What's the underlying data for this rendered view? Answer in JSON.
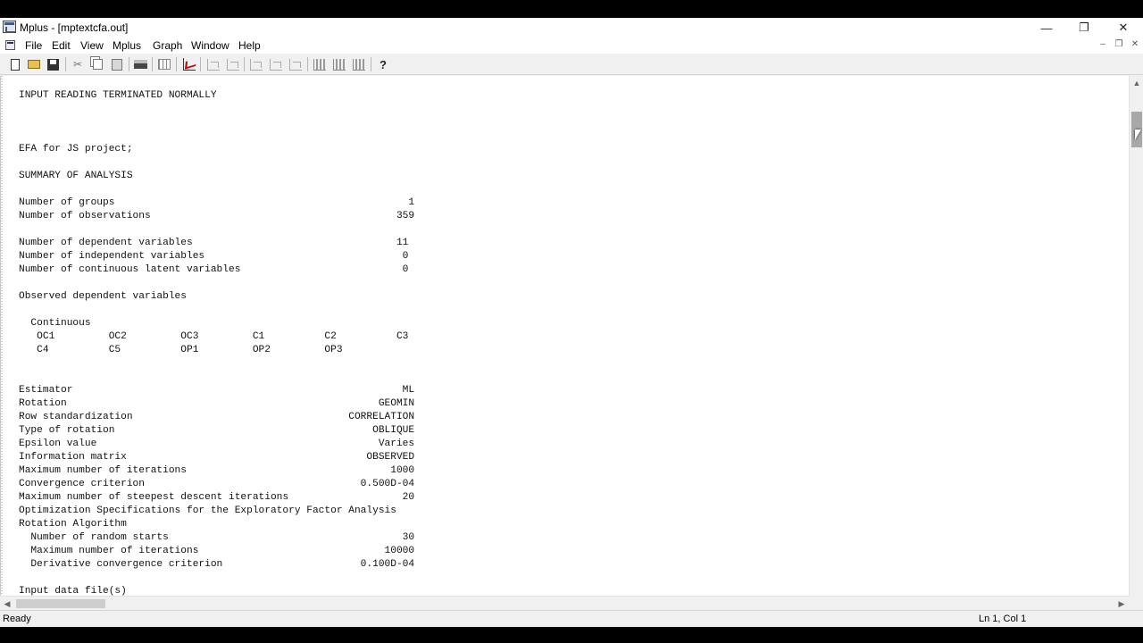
{
  "window": {
    "title": "Mplus - [mptextcfa.out]",
    "minimize_glyph": "—",
    "restore_glyph": "❐",
    "close_glyph": "✕"
  },
  "menu": {
    "items": [
      "File",
      "Edit",
      "View",
      "Mplus",
      "Graph",
      "Window",
      "Help"
    ],
    "mdi_minimize": "–",
    "mdi_restore": "❐",
    "mdi_close": "✕"
  },
  "toolbar": {
    "icons": [
      "new-file-icon",
      "open-folder-icon",
      "save-icon",
      "cut-icon",
      "copy-icon",
      "paste-icon",
      "print-icon",
      "data-grid-icon",
      "plot-icon",
      "line-plot-disabled-icon",
      "scatter-disabled-icon",
      "prev-disabled-icon",
      "next-disabled-icon",
      "zoom-disabled-icon",
      "histogram-icon",
      "bar-chart-icon",
      "column-chart-icon",
      "help-icon"
    ],
    "help_label": "?"
  },
  "document": {
    "lines": [
      "INPUT READING TERMINATED NORMALLY",
      "",
      "",
      "",
      "EFA for JS project;",
      "",
      "SUMMARY OF ANALYSIS",
      "",
      "Number of groups                                                 1",
      "Number of observations                                         359",
      "",
      "Number of dependent variables                                  11",
      "Number of independent variables                                 0",
      "Number of continuous latent variables                           0",
      "",
      "Observed dependent variables",
      "",
      "  Continuous",
      "   OC1         OC2         OC3         C1          C2          C3",
      "   C4          C5          OP1         OP2         OP3",
      "",
      "",
      "Estimator                                                       ML",
      "Rotation                                                    GEOMIN",
      "Row standardization                                    CORRELATION",
      "Type of rotation                                           OBLIQUE",
      "Epsilon value                                               Varies",
      "Information matrix                                        OBSERVED",
      "Maximum number of iterations                                  1000",
      "Convergence criterion                                    0.500D-04",
      "Maximum number of steepest descent iterations                   20",
      "Optimization Specifications for the Exploratory Factor Analysis",
      "Rotation Algorithm",
      "  Number of random starts                                       30",
      "  Maximum number of iterations                               10000",
      "  Derivative convergence criterion                       0.100D-04",
      "",
      "Input data file(s)"
    ]
  },
  "scrollbars": {
    "up_arrow": "▲",
    "down_arrow": "▼",
    "left_arrow": "◀",
    "right_arrow": "▶"
  },
  "status": {
    "left": "Ready",
    "right": "Ln 1, Col 1"
  }
}
